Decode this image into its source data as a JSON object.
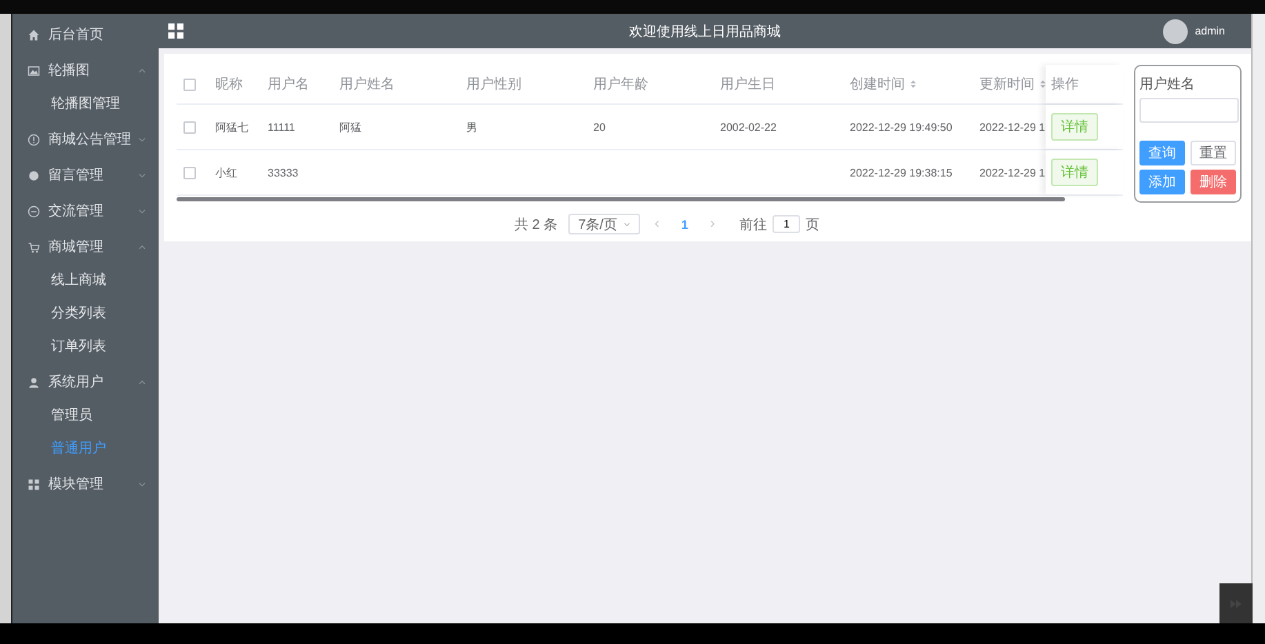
{
  "sidebar": {
    "items": [
      {
        "label": "后台首页",
        "selected": false
      },
      {
        "label": "轮播图",
        "expanded": true,
        "children": [
          {
            "label": "轮播图管理",
            "selected": false
          }
        ]
      },
      {
        "label": "商城公告管理",
        "expanded": false
      },
      {
        "label": "留言管理",
        "expanded": false
      },
      {
        "label": "交流管理",
        "expanded": false
      },
      {
        "label": "商城管理",
        "expanded": true,
        "children": [
          {
            "label": "线上商城",
            "selected": false
          },
          {
            "label": "分类列表",
            "selected": false
          },
          {
            "label": "订单列表",
            "selected": false
          }
        ]
      },
      {
        "label": "系统用户",
        "expanded": true,
        "children": [
          {
            "label": "管理员",
            "selected": false
          },
          {
            "label": "普通用户",
            "selected": true
          }
        ]
      },
      {
        "label": "模块管理",
        "expanded": false
      }
    ]
  },
  "header": {
    "title": "欢迎使用线上日用品商城",
    "user": "admin"
  },
  "table": {
    "select_all": {
      "checked": false
    },
    "columns": [
      {
        "label": "昵称",
        "sortable": false
      },
      {
        "label": "用户名",
        "sortable": false
      },
      {
        "label": "用户姓名",
        "sortable": false
      },
      {
        "label": "用户性别",
        "sortable": false
      },
      {
        "label": "用户年龄",
        "sortable": false
      },
      {
        "label": "用户生日",
        "sortable": false
      },
      {
        "label": "创建时间",
        "sortable": true
      },
      {
        "label": "更新时间",
        "sortable": true
      },
      {
        "label": "操作",
        "sortable": false
      }
    ],
    "rows": [
      {
        "checked": false,
        "cells": [
          "阿猛七",
          "11111",
          "阿猛",
          "男",
          "20",
          "2002-02-22",
          "2022-12-29 19:49:50",
          "2022-12-29 1"
        ],
        "action": "详情"
      },
      {
        "checked": false,
        "cells": [
          "小红",
          "33333",
          "",
          "",
          "",
          "",
          "2022-12-29 19:38:15",
          "2022-12-29 1"
        ],
        "action": "详情"
      }
    ]
  },
  "pagination": {
    "total": "共 2 条",
    "page_size": "7条/页",
    "prev": "‹",
    "pages": [
      {
        "label": "1",
        "selected": true
      }
    ],
    "next": "›",
    "goto_label": "前往",
    "goto_value": "1",
    "goto_unit": "页"
  },
  "search_panel": {
    "label": "用户姓名",
    "buttons": [
      {
        "label": "查询",
        "kind": "primary"
      },
      {
        "label": "重置",
        "kind": "plain"
      },
      {
        "label": "添加",
        "kind": "primary"
      },
      {
        "label": "删除",
        "kind": "danger"
      }
    ]
  }
}
